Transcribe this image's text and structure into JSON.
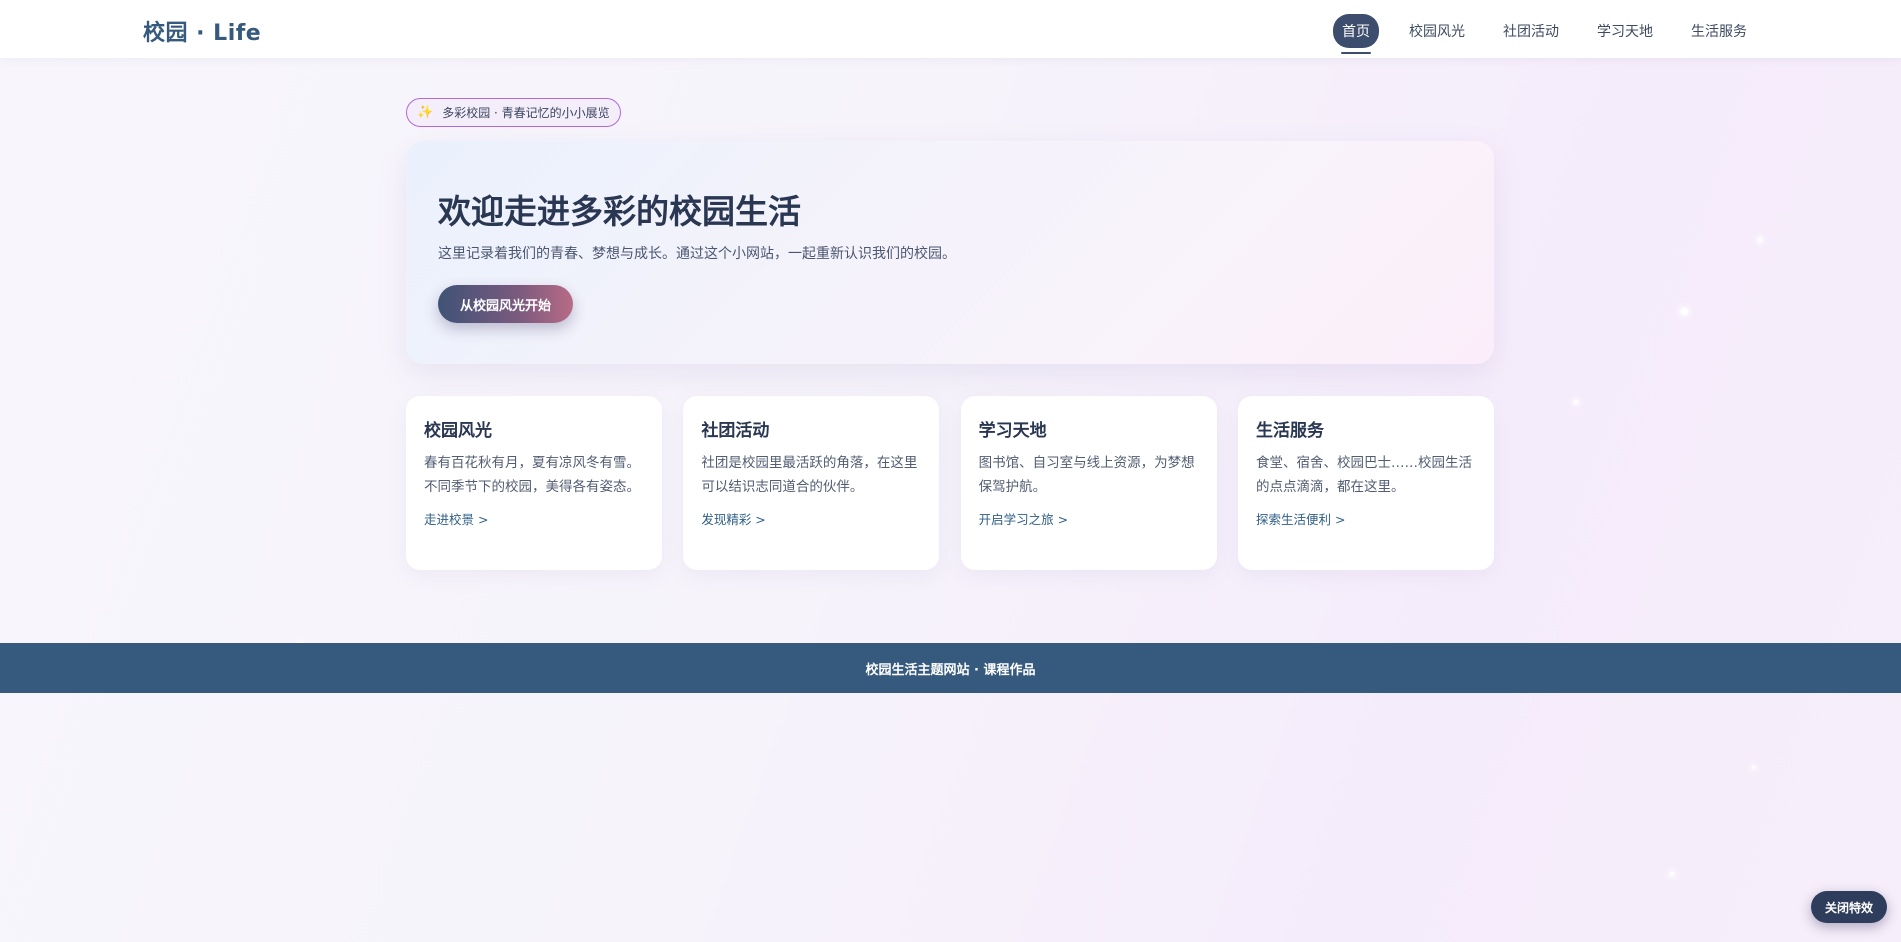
{
  "nav": {
    "brand": "校园 · Life",
    "items": [
      {
        "label": "首页",
        "active": true
      },
      {
        "label": "校园风光",
        "active": false
      },
      {
        "label": "社团活动",
        "active": false
      },
      {
        "label": "学习天地",
        "active": false
      },
      {
        "label": "生活服务",
        "active": false
      }
    ]
  },
  "tag": {
    "icon": "sparkles-icon",
    "text": "多彩校园 · 青春记忆的小小展览"
  },
  "hero": {
    "title": "欢迎走进多彩的校园生活",
    "subtitle": "这里记录着我们的青春、梦想与成长。通过这个小网站，一起重新认识我们的校园。",
    "button_label": "从校园风光开始"
  },
  "cards": [
    {
      "title": "校园风光",
      "desc": "春有百花秋有月，夏有凉风冬有雪。不同季节下的校园，美得各有姿态。",
      "link": "走进校景 >"
    },
    {
      "title": "社团活动",
      "desc": "社团是校园里最活跃的角落，在这里可以结识志同道合的伙伴。",
      "link": "发现精彩 >"
    },
    {
      "title": "学习天地",
      "desc": "图书馆、自习室与线上资源，为梦想保驾护航。",
      "link": "开启学习之旅 >"
    },
    {
      "title": "生活服务",
      "desc": "食堂、宿舍、校园巴士……校园生活的点点滴滴，都在这里。",
      "link": "探索生活便利 >"
    }
  ],
  "footer": {
    "text": "校园生活主题网站 · 课程作品"
  },
  "effects_toggle": {
    "label": "关闭特效"
  },
  "colors": {
    "brand": "#355a7d",
    "nav_active": "#3d4d6e",
    "tag_border": "#b06adf",
    "footer_bg": "#355a7d"
  }
}
